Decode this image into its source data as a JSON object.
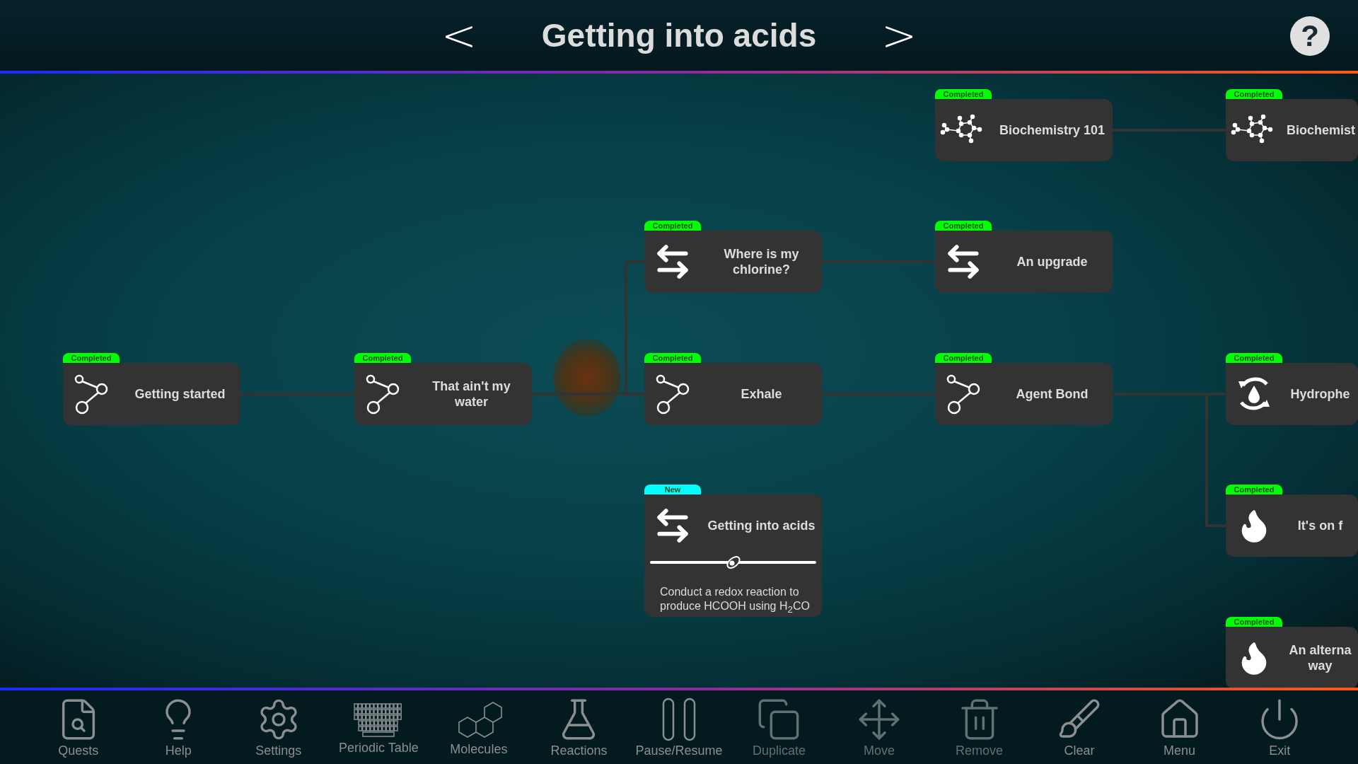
{
  "header": {
    "title": "Getting into acids",
    "prev": "<",
    "next": ">",
    "help": "?"
  },
  "quests": [
    {
      "title": "Biochemistry 101",
      "kind": "molecule",
      "badge": {
        "label": "Completed",
        "kind": "completed"
      }
    },
    {
      "title": "Biochemist",
      "kind": "molecule",
      "badge": {
        "label": "Completed",
        "kind": "completed"
      }
    },
    {
      "title": "Where is my chlorine?",
      "kind": "arrows",
      "badge": {
        "label": "Completed",
        "kind": "completed"
      }
    },
    {
      "title": "An upgrade",
      "kind": "arrows",
      "badge": {
        "label": "Completed",
        "kind": "completed"
      }
    },
    {
      "title": "Getting started",
      "kind": "nodes",
      "badge": {
        "label": "Completed",
        "kind": "completed"
      }
    },
    {
      "title": "That ain't my water",
      "kind": "nodes",
      "badge": {
        "label": "Completed",
        "kind": "completed"
      }
    },
    {
      "title": "Exhale",
      "kind": "nodes",
      "badge": {
        "label": "Completed",
        "kind": "completed"
      }
    },
    {
      "title": "Agent Bond",
      "kind": "nodes",
      "badge": {
        "label": "Completed",
        "kind": "completed"
      }
    },
    {
      "title": "Hydrophe",
      "kind": "cycle",
      "badge": {
        "label": "Completed",
        "kind": "completed"
      }
    },
    {
      "title": "Getting into acids",
      "kind": "arrows",
      "badge": {
        "label": "New",
        "kind": "new"
      },
      "level": 0.5,
      "description": "Conduct a redox reaction to produce HCOOH using H$_{2}$CO"
    },
    {
      "title": "It's on f",
      "kind": "flame",
      "badge": {
        "label": "Completed",
        "kind": "completed"
      }
    },
    {
      "title": "An alterna way",
      "kind": "flame",
      "badge": {
        "label": "Completed",
        "kind": "completed"
      }
    }
  ],
  "toolbar": [
    {
      "label": "Quests",
      "kind": "quests",
      "disabled": false
    },
    {
      "label": "Help",
      "kind": "help",
      "disabled": false
    },
    {
      "label": "Settings",
      "kind": "settings",
      "disabled": false
    },
    {
      "label": "Periodic Table",
      "kind": "periodic",
      "disabled": false
    },
    {
      "label": "Molecules",
      "kind": "molecules",
      "disabled": false
    },
    {
      "label": "Reactions",
      "kind": "reactions",
      "disabled": false
    },
    {
      "label": "Pause/Resume",
      "kind": "pause",
      "disabled": false
    },
    {
      "label": "Duplicate",
      "kind": "duplicate",
      "disabled": true
    },
    {
      "label": "Move",
      "kind": "move",
      "disabled": true
    },
    {
      "label": "Remove",
      "kind": "remove",
      "disabled": true
    },
    {
      "label": "Clear",
      "kind": "clear",
      "disabled": false
    },
    {
      "label": "Menu",
      "kind": "menu",
      "disabled": false
    },
    {
      "label": "Exit",
      "kind": "exit",
      "disabled": false
    }
  ]
}
